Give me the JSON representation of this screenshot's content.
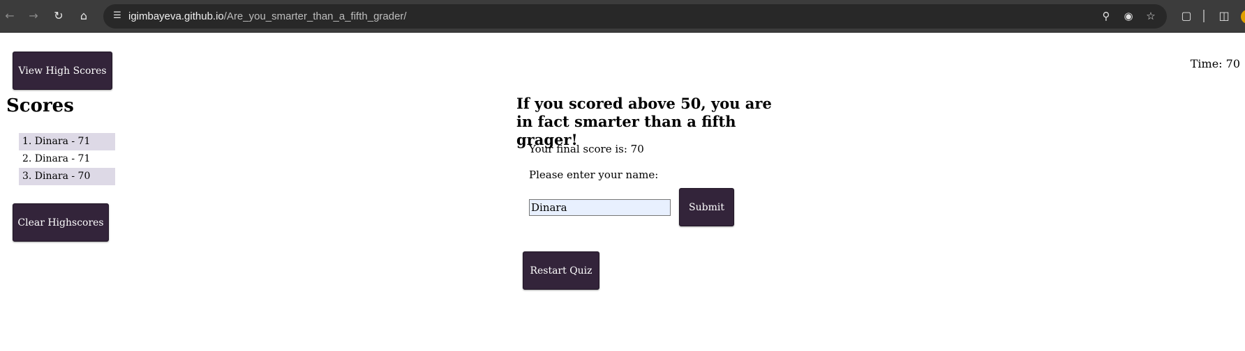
{
  "browser": {
    "url_host": "igimbayeva.github.io",
    "url_path": "/Are_you_smarter_than_a_fifth_grader/"
  },
  "page": {
    "view_high_scores_label": "View High Scores",
    "timer_text": "Time: 70",
    "scores_heading": "Scores",
    "scores": [
      "1. Dinara - 71",
      "2. Dinara - 71",
      "3. Dinara - 70"
    ],
    "clear_highscores_label": "Clear Highscores",
    "headline": "If you scored above 50, you are in fact smarter than a fifth grager!",
    "final_score_text": "Your final score is: 70",
    "name_prompt": "Please enter your name:",
    "name_value": "Dinara",
    "submit_label": "Submit",
    "restart_label": "Restart Quiz"
  },
  "colors": {
    "button_bg": "#33243a",
    "list_stripe": "#ddd9e6",
    "chrome_bg": "#3c3c3c"
  }
}
